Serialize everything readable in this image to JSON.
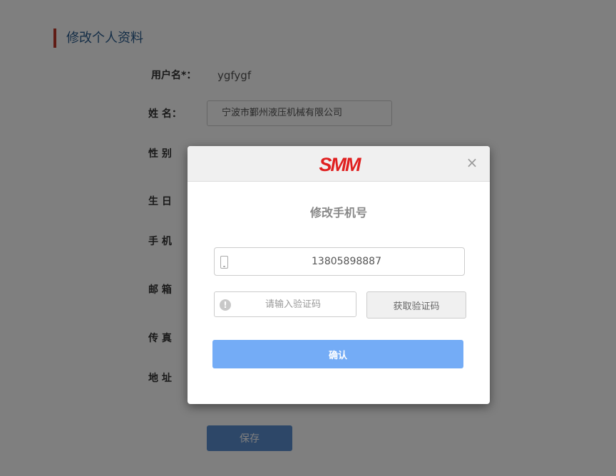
{
  "page": {
    "title": "修改个人资料",
    "fields": {
      "username_label": "用户名*：",
      "username_value": "ygfygf",
      "name_label": "姓 名：",
      "name_value": "宁波市鄞州液压机械有限公司",
      "gender_label": "性 别",
      "birthday_label": "生 日",
      "phone_label": "手 机",
      "email_label": "邮 箱",
      "fax_label": "传 真",
      "address_label": "地 址"
    },
    "save_label": "保存"
  },
  "modal": {
    "logo_text": "SMM",
    "close_icon": "×",
    "title": "修改手机号",
    "phone_value": "13805898887",
    "code_placeholder": "请输入验证码",
    "get_code_label": "获取验证码",
    "confirm_label": "确认",
    "colors": {
      "confirm": "#74acf6",
      "logo": "#e02020"
    }
  }
}
